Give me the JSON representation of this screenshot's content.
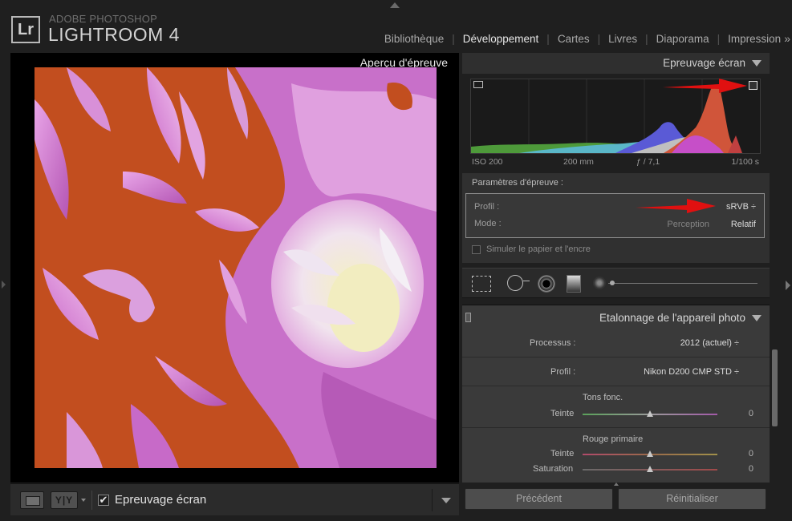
{
  "header": {
    "logo": "Lr",
    "brand_small": "ADOBE PHOTOSHOP",
    "brand_big": "LIGHTROOM 4",
    "modules": [
      "Bibliothèque",
      "Développement",
      "Cartes",
      "Livres",
      "Diaporama",
      "Impression"
    ],
    "active_module": "Développement",
    "more": "»"
  },
  "image_area": {
    "preview_label": "Aperçu d'épreuve"
  },
  "toolbar": {
    "yy_label": "Y|Y",
    "proof_check": "✔",
    "proof_label": "Epreuvage écran"
  },
  "proof_panel": {
    "title": "Epreuvage écran",
    "hist_info": {
      "iso": "ISO 200",
      "focal": "200 mm",
      "aperture": "ƒ / 7,1",
      "shutter": "1/100 s"
    },
    "params_title": "Paramètres d'épreuve :",
    "profile_label": "Profil :",
    "profile_value": "sRVB ÷",
    "mode_label": "Mode :",
    "mode_perception": "Perception",
    "mode_relatif": "Relatif",
    "simulate_label": "Simuler le papier et l'encre"
  },
  "calibration_panel": {
    "title": "Etalonnage de l'appareil photo",
    "process_label": "Processus :",
    "process_value": "2012 (actuel) ÷",
    "profile_label": "Profil :",
    "profile_value": "Nikon D200 CMP STD ÷",
    "shadows_title": "Tons fonc.",
    "shadows_tint_label": "Teinte",
    "shadows_tint_value": "0",
    "red_title": "Rouge primaire",
    "red_tint_label": "Teinte",
    "red_tint_value": "0",
    "red_sat_label": "Saturation",
    "red_sat_value": "0"
  },
  "buttons": {
    "previous": "Précédent",
    "reset": "Réinitialiser"
  },
  "colors": {
    "background": "#1f1f1f",
    "panel": "#3a3a3a",
    "photo_orange": "#c24e1f",
    "petal_pink": "#d97fd6",
    "arrow_red": "#e01010"
  }
}
